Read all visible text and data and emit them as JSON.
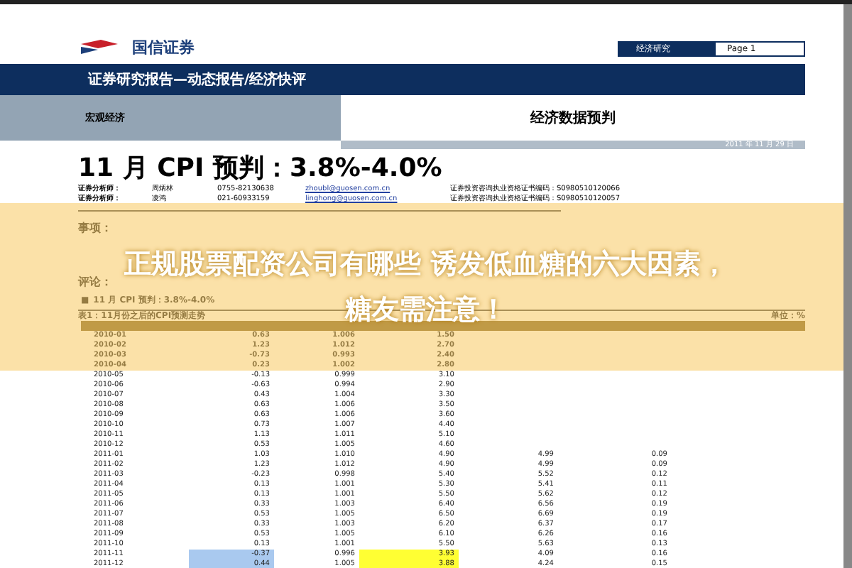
{
  "header": {
    "logo_text": "国信证券",
    "tag": "经济研究",
    "page": "Page 1"
  },
  "report_type": "证券研究报告—动态报告/经济快评",
  "section": {
    "category": "宏观经济",
    "topic": "经济数据预判"
  },
  "date": "2011 年 11 月 29 日",
  "title": "11 月 CPI 预判：3.8%-4.0%",
  "analysts": [
    {
      "label": "证券分析师：",
      "name": "周炳林",
      "phone": "0755-82130638",
      "email": "zhoubl@guosen.com.cn",
      "cert": "证券投资咨询执业资格证书编码：S0980510120066"
    },
    {
      "label": "证券分析师：",
      "name": "凌鸿",
      "phone": "021-60933159",
      "email": "linghong@guosen.com.cn",
      "cert": "证券投资咨询执业资格证书编码：S0980510120057"
    }
  ],
  "items_heading": "事项：",
  "comment_heading": "评论：",
  "bullet": {
    "marker": "■",
    "text": "11 月 CPI 预判：3.8%-4.0%"
  },
  "table": {
    "caption": "表1：11月份之后的CPI预测走势",
    "unit": "单位：%",
    "rows": [
      {
        "cells": [
          "2010-01",
          "0.63",
          "1.006",
          "1.50"
        ],
        "forecast": false
      },
      {
        "cells": [
          "2010-02",
          "1.23",
          "1.012",
          "2.70"
        ],
        "forecast": false
      },
      {
        "cells": [
          "2010-03",
          "-0.73",
          "0.993",
          "2.40"
        ],
        "forecast": false
      },
      {
        "cells": [
          "2010-04",
          "0.23",
          "1.002",
          "2.80"
        ],
        "forecast": false
      },
      {
        "cells": [
          "2010-05",
          "-0.13",
          "0.999",
          "3.10"
        ],
        "forecast": false
      },
      {
        "cells": [
          "2010-06",
          "-0.63",
          "0.994",
          "2.90"
        ],
        "forecast": false
      },
      {
        "cells": [
          "2010-07",
          "0.43",
          "1.004",
          "3.30"
        ],
        "forecast": false
      },
      {
        "cells": [
          "2010-08",
          "0.63",
          "1.006",
          "3.50"
        ],
        "forecast": false
      },
      {
        "cells": [
          "2010-09",
          "0.63",
          "1.006",
          "3.60"
        ],
        "forecast": false
      },
      {
        "cells": [
          "2010-10",
          "0.73",
          "1.007",
          "4.40"
        ],
        "forecast": false
      },
      {
        "cells": [
          "2010-11",
          "1.13",
          "1.011",
          "5.10"
        ],
        "forecast": false
      },
      {
        "cells": [
          "2010-12",
          "0.53",
          "1.005",
          "4.60"
        ],
        "forecast": false
      },
      {
        "cells": [
          "2011-01",
          "1.03",
          "1.010",
          "4.90",
          "4.99",
          "0.09"
        ],
        "forecast": false
      },
      {
        "cells": [
          "2011-02",
          "1.23",
          "1.012",
          "4.90",
          "4.99",
          "0.09"
        ],
        "forecast": false
      },
      {
        "cells": [
          "2011-03",
          "-0.23",
          "0.998",
          "5.40",
          "5.52",
          "0.12"
        ],
        "forecast": false
      },
      {
        "cells": [
          "2011-04",
          "0.13",
          "1.001",
          "5.30",
          "5.41",
          "0.11"
        ],
        "forecast": false
      },
      {
        "cells": [
          "2011-05",
          "0.13",
          "1.001",
          "5.50",
          "5.62",
          "0.12"
        ],
        "forecast": false
      },
      {
        "cells": [
          "2011-06",
          "0.33",
          "1.003",
          "6.40",
          "6.56",
          "0.19"
        ],
        "forecast": false
      },
      {
        "cells": [
          "2011-07",
          "0.53",
          "1.005",
          "6.50",
          "6.69",
          "0.19"
        ],
        "forecast": false
      },
      {
        "cells": [
          "2011-08",
          "0.33",
          "1.003",
          "6.20",
          "6.37",
          "0.17"
        ],
        "forecast": false
      },
      {
        "cells": [
          "2011-09",
          "0.53",
          "1.005",
          "6.10",
          "6.26",
          "0.16"
        ],
        "forecast": false
      },
      {
        "cells": [
          "2011-10",
          "0.13",
          "1.001",
          "5.50",
          "5.63",
          "0.13"
        ],
        "forecast": false
      },
      {
        "cells": [
          "2011-11",
          "-0.37",
          "0.996",
          "3.93",
          "4.09",
          "0.16"
        ],
        "forecast": true
      },
      {
        "cells": [
          "2011-12",
          "0.44",
          "1.005",
          "3.88",
          "4.24",
          "0.15"
        ],
        "forecast": true
      }
    ]
  },
  "banner": {
    "lines": [
      "正规股票配资公司有哪些 诱发低血糖的六大因素，",
      "糖友需注意！"
    ]
  }
}
